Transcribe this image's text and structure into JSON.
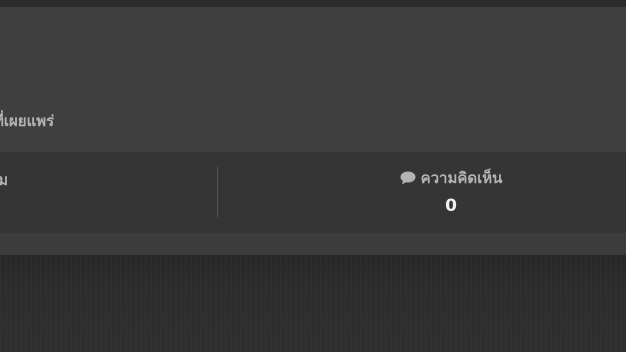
{
  "card": {
    "published_label": "ที่เผยแพร่",
    "stats": {
      "left_label": "ชม",
      "comments": {
        "icon": "comment-icon",
        "label": "ความคิดเห็น",
        "count": "0"
      }
    }
  },
  "colors": {
    "card_background": "#3e3e3e",
    "stats_background": "#353535",
    "label_text": "#b3b3b3",
    "count_text": "#f0f0f0",
    "page_background": "#2c2c2c"
  }
}
